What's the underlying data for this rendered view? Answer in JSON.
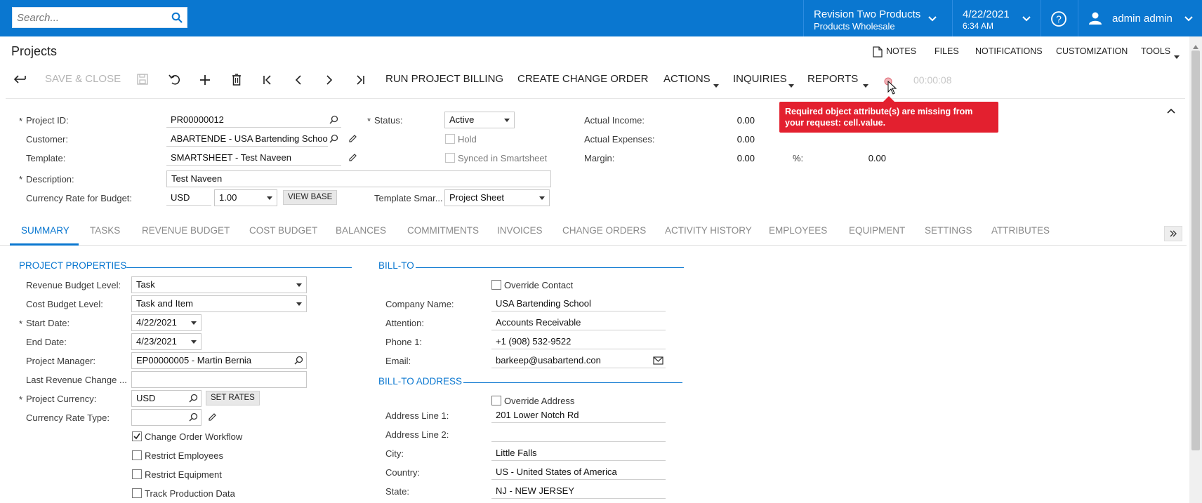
{
  "topbar": {
    "search_placeholder": "Search...",
    "company": "Revision Two Products",
    "branch": "Products Wholesale",
    "date": "4/22/2021",
    "time": "6:34 AM",
    "user": "admin admin",
    "brand_color": "#0a77d0"
  },
  "page": {
    "title": "Projects",
    "util_links": [
      "NOTES",
      "FILES",
      "NOTIFICATIONS",
      "CUSTOMIZATION",
      "TOOLS"
    ]
  },
  "toolbar": {
    "save_close": "SAVE & CLOSE",
    "run_billing": "RUN PROJECT BILLING",
    "create_change_order": "CREATE CHANGE ORDER",
    "actions": "ACTIONS",
    "inquiries": "INQUIRIES",
    "reports": "REPORTS",
    "timer": "00:00:08"
  },
  "alert": {
    "message": "Required object attribute(s) are missing from your request: cell.value.",
    "color": "#e3202f"
  },
  "header_form": {
    "project_id_label": "Project ID:",
    "project_id": "PR00000012",
    "customer_label": "Customer:",
    "customer": "ABARTENDE - USA Bartending School",
    "template_label": "Template:",
    "template": "SMARTSHEET - Test Naveen",
    "description_label": "Description:",
    "description": "Test Naveen",
    "currency_rate_label": "Currency Rate for Budget:",
    "currency": "USD",
    "rate": "1.00",
    "view_base": "VIEW BASE",
    "status_label": "Status:",
    "status": "Active",
    "hold_label": "Hold",
    "synced_label": "Synced in Smartsheet",
    "template_smart_label": "Template Smar...",
    "template_smart": "Project Sheet",
    "actual_income_label": "Actual Income:",
    "actual_income": "0.00",
    "actual_expenses_label": "Actual Expenses:",
    "actual_expenses": "0.00",
    "margin_label": "Margin:",
    "margin": "0.00",
    "pct_label": "%:",
    "pct": "0.00"
  },
  "tabs": [
    "SUMMARY",
    "TASKS",
    "REVENUE BUDGET",
    "COST BUDGET",
    "BALANCES",
    "COMMITMENTS",
    "INVOICES",
    "CHANGE ORDERS",
    "ACTIVITY HISTORY",
    "EMPLOYEES",
    "EQUIPMENT",
    "SETTINGS",
    "ATTRIBUTES"
  ],
  "project_properties": {
    "title": "PROJECT PROPERTIES",
    "revenue_budget_level_label": "Revenue Budget Level:",
    "revenue_budget_level": "Task",
    "cost_budget_level_label": "Cost Budget Level:",
    "cost_budget_level": "Task and Item",
    "start_date_label": "Start Date:",
    "start_date": "4/22/2021",
    "end_date_label": "End Date:",
    "end_date": "4/23/2021",
    "project_manager_label": "Project Manager:",
    "project_manager": "EP00000005 - Martin Bernia",
    "last_revenue_change_label": "Last Revenue Change ...",
    "last_revenue_change": "",
    "project_currency_label": "Project Currency:",
    "project_currency": "USD",
    "set_rates": "SET RATES",
    "currency_rate_type_label": "Currency Rate Type:",
    "currency_rate_type": "",
    "change_order_workflow_label": "Change Order Workflow",
    "restrict_employees_label": "Restrict Employees",
    "restrict_equipment_label": "Restrict Equipment",
    "track_production_label": "Track Production Data"
  },
  "bill_to": {
    "title": "BILL-TO",
    "override_contact_label": "Override Contact",
    "company_name_label": "Company Name:",
    "company_name": "USA Bartending School",
    "attention_label": "Attention:",
    "attention": "Accounts Receivable",
    "phone_label": "Phone 1:",
    "phone": "+1 (908) 532-9522",
    "email_label": "Email:",
    "email": "barkeep@usabartend.con"
  },
  "bill_to_address": {
    "title": "BILL-TO ADDRESS",
    "override_address_label": "Override Address",
    "address1_label": "Address Line 1:",
    "address1": "201 Lower Notch Rd",
    "address2_label": "Address Line 2:",
    "address2": "",
    "city_label": "City:",
    "city": "Little Falls",
    "country_label": "Country:",
    "country": "US - United States of America",
    "state_label": "State:",
    "state": "NJ - NEW JERSEY"
  }
}
